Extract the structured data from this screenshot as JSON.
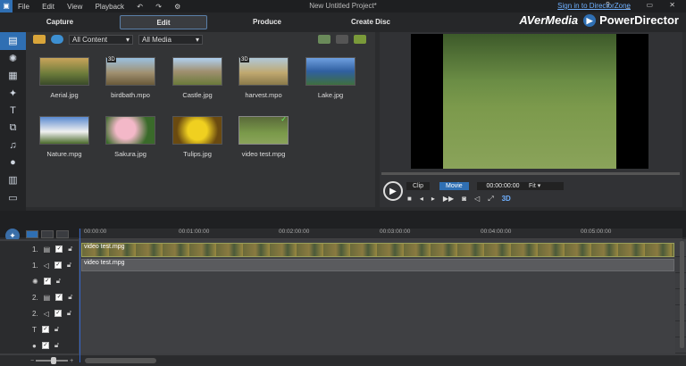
{
  "titlebar": {
    "menu": [
      "File",
      "Edit",
      "View",
      "Playback"
    ],
    "title": "New Untitled Project*",
    "signin": "Sign in to DirectorZone",
    "win_buttons": "? _ ▭ ✕"
  },
  "tabs": [
    "Capture",
    "Edit",
    "Produce",
    "Create Disc"
  ],
  "brand": {
    "avermedia": "AVerMedia",
    "powerdirector": "PowerDirector"
  },
  "library": {
    "content_filter": "All Content",
    "media_filter": "All Media",
    "items": [
      {
        "name": "Aerial.jpg",
        "badge": ""
      },
      {
        "name": "birdbath.mpo",
        "badge": "3D"
      },
      {
        "name": "Castle.jpg",
        "badge": ""
      },
      {
        "name": "harvest.mpo",
        "badge": "3D"
      },
      {
        "name": "Lake.jpg",
        "badge": ""
      },
      {
        "name": "Nature.mpg",
        "badge": ""
      },
      {
        "name": "Sakura.jpg",
        "badge": ""
      },
      {
        "name": "Tulips.jpg",
        "badge": ""
      },
      {
        "name": "video test.mpg",
        "badge": "",
        "check": "✓"
      }
    ]
  },
  "preview": {
    "clip": "Clip",
    "movie": "Movie",
    "timecode": "00:00:00:00",
    "fit": "Fit",
    "mode3d": "3D"
  },
  "ruler": [
    "00:00:00",
    "00:01:00:00",
    "00:02:00:00",
    "00:03:00:00",
    "00:04:00:00",
    "00:05:00:00"
  ],
  "tracks": {
    "video_clip": "video test.mpg",
    "audio_clip": "video test.mpg",
    "track_numbers": [
      "1.",
      "1.",
      "",
      "2.",
      "2.",
      "",
      "",
      ""
    ]
  },
  "colors": {
    "accent": "#2f6fb3",
    "link": "#6fb0ff"
  }
}
